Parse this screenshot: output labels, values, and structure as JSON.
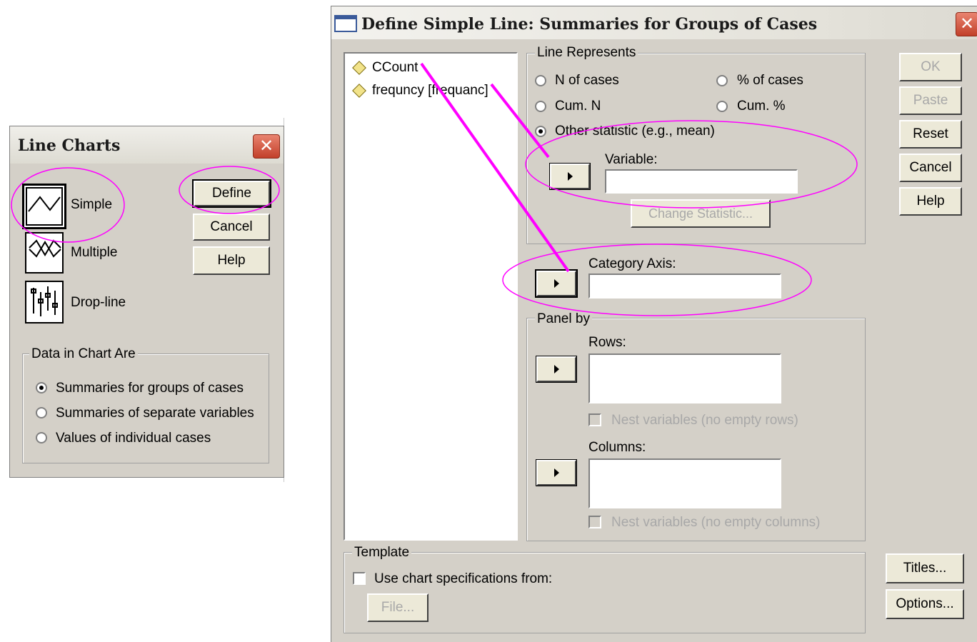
{
  "line_charts": {
    "title": "Line Charts",
    "close_glyph": "✕",
    "types": [
      {
        "label": "Simple",
        "icon": "simple-line-chart-icon"
      },
      {
        "label": "Multiple",
        "icon": "multiple-line-chart-icon"
      },
      {
        "label": "Drop-line",
        "icon": "drop-line-chart-icon"
      }
    ],
    "buttons": {
      "define": "Define",
      "cancel": "Cancel",
      "help": "Help"
    },
    "data_group": {
      "legend": "Data in Chart Are",
      "options": [
        {
          "label": "Summaries for groups of cases",
          "selected": true
        },
        {
          "label": "Summaries of separate variables",
          "selected": false
        },
        {
          "label": "Values of individual cases",
          "selected": false
        }
      ]
    }
  },
  "define_dialog": {
    "title": "Define Simple Line: Summaries for Groups of Cases",
    "close_glyph": "✕",
    "variables": [
      {
        "label": "CCount",
        "icon": "scale-variable-icon"
      },
      {
        "label": "frequncy [frequanc]",
        "icon": "scale-variable-icon"
      }
    ],
    "line_represents": {
      "legend": "Line Represents",
      "options": [
        {
          "label": "N of cases",
          "selected": false
        },
        {
          "label": "% of cases",
          "selected": false
        },
        {
          "label": "Cum. N",
          "selected": false
        },
        {
          "label": "Cum. %",
          "selected": false
        },
        {
          "label": "Other statistic (e.g., mean)",
          "selected": true
        }
      ],
      "variable_label": "Variable:",
      "variable_value": "",
      "change_statistic": "Change Statistic..."
    },
    "category_axis": {
      "label": "Category Axis:",
      "value": ""
    },
    "panel_by": {
      "legend": "Panel by",
      "rows_label": "Rows:",
      "nest_rows": "Nest variables (no empty rows)",
      "columns_label": "Columns:",
      "nest_columns": "Nest variables (no empty columns)"
    },
    "template": {
      "legend": "Template",
      "use_spec": "Use chart specifications from:",
      "file": "File..."
    },
    "buttons": {
      "ok": "OK",
      "paste": "Paste",
      "reset": "Reset",
      "cancel": "Cancel",
      "help": "Help",
      "titles": "Titles...",
      "options": "Options..."
    }
  },
  "colors": {
    "dialog_bg": "#d4d0c8",
    "annotation": "#ff00ff",
    "close_red": "#c2402a"
  }
}
